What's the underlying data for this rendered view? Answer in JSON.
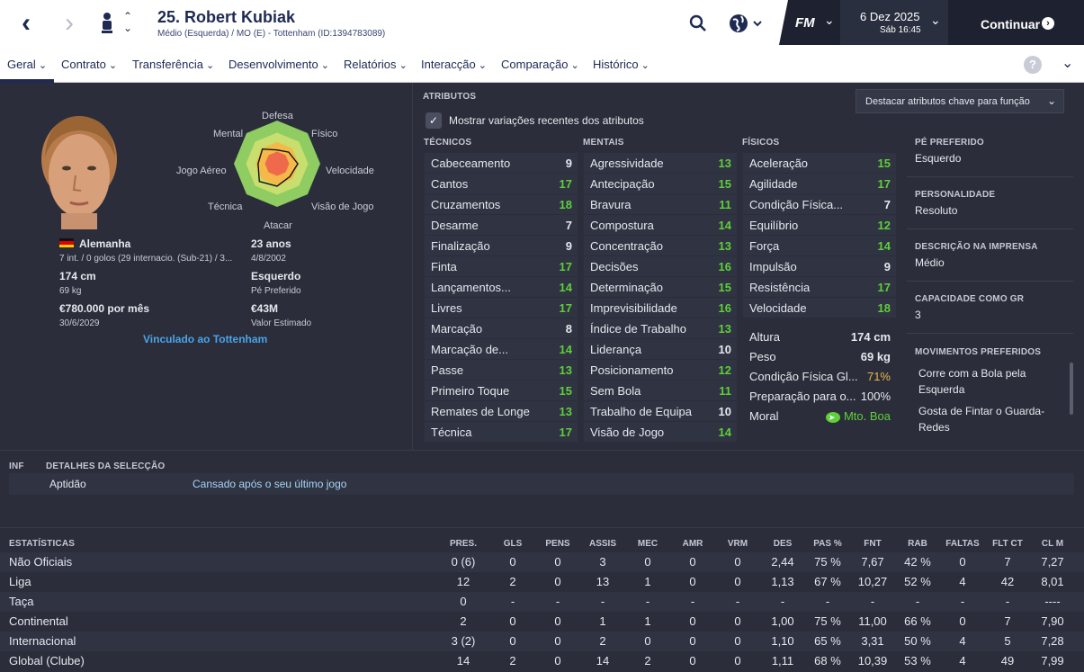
{
  "header": {
    "player_name": "25. Robert Kubiak",
    "subtitle": "Médio (Esquerda) / MO (E) - Tottenham (ID:1394783089)",
    "date": "6 Dez 2025",
    "day_time": "Sáb 16:45",
    "continue_label": "Continuar",
    "fm_logo": "FM"
  },
  "tabs": [
    "Geral",
    "Contrato",
    "Transferência",
    "Desenvolvimento",
    "Relatórios",
    "Interacção",
    "Comparação",
    "Histórico"
  ],
  "radar": {
    "labels": [
      "Defesa",
      "Físico",
      "Velocidade",
      "Visão de Jogo",
      "Atacar",
      "Técnica",
      "Jogo Aéreo",
      "Mental"
    ],
    "values": [
      0.32,
      0.38,
      0.48,
      0.42,
      0.52,
      0.58,
      0.44,
      0.48
    ]
  },
  "profile": {
    "nationality": "Alemanha",
    "caps": "7 int. / 0 golos (29 internacio. (Sub-21) / 3...",
    "age": "23 anos",
    "dob": "4/8/2002",
    "height": "174 cm",
    "height_lbl": "",
    "weight": "69 kg",
    "foot": "Esquerdo",
    "foot_lbl": "Pé Preferido",
    "wage": "€780.000 por mês",
    "contract": "30/6/2029",
    "value": "€43M",
    "value_lbl": "Valor Estimado",
    "club_link": "Vinculado ao Tottenham"
  },
  "attributes": {
    "title": "ATRIBUTOS",
    "highlight_btn": "Destacar atributos chave para função",
    "show_changes": "Mostrar variações recentes dos atributos",
    "tech_title": "TÉCNICOS",
    "ment_title": "MENTAIS",
    "phys_title": "FÍSICOS",
    "technical": [
      [
        "Cabeceamento",
        "9"
      ],
      [
        "Cantos",
        "17"
      ],
      [
        "Cruzamentos",
        "18"
      ],
      [
        "Desarme",
        "7"
      ],
      [
        "Finalização",
        "9"
      ],
      [
        "Finta",
        "17"
      ],
      [
        "Lançamentos...",
        "14"
      ],
      [
        "Livres",
        "17"
      ],
      [
        "Marcação",
        "8"
      ],
      [
        "Marcação de...",
        "14"
      ],
      [
        "Passe",
        "13"
      ],
      [
        "Primeiro Toque",
        "15"
      ],
      [
        "Remates de Longe",
        "13"
      ],
      [
        "Técnica",
        "17"
      ]
    ],
    "mental": [
      [
        "Agressividade",
        "13"
      ],
      [
        "Antecipação",
        "15"
      ],
      [
        "Bravura",
        "11"
      ],
      [
        "Compostura",
        "14"
      ],
      [
        "Concentração",
        "13"
      ],
      [
        "Decisões",
        "16"
      ],
      [
        "Determinação",
        "15"
      ],
      [
        "Imprevisibilidade",
        "16"
      ],
      [
        "Índice de Trabalho",
        "13"
      ],
      [
        "Liderança",
        "10"
      ],
      [
        "Posicionamento",
        "12"
      ],
      [
        "Sem Bola",
        "11"
      ],
      [
        "Trabalho de Equipa",
        "10"
      ],
      [
        "Visão de Jogo",
        "14"
      ]
    ],
    "physical": [
      [
        "Aceleração",
        "15"
      ],
      [
        "Agilidade",
        "17"
      ],
      [
        "Condição Física...",
        "7"
      ],
      [
        "Equilíbrio",
        "12"
      ],
      [
        "Força",
        "14"
      ],
      [
        "Impulsão",
        "9"
      ],
      [
        "Resistência",
        "17"
      ],
      [
        "Velocidade",
        "18"
      ]
    ],
    "extra": [
      [
        "Altura",
        "174 cm"
      ],
      [
        "Peso",
        "69 kg"
      ],
      [
        "Condição Física Gl...",
        "71%"
      ],
      [
        "Preparação para o...",
        "100%"
      ],
      [
        "Moral",
        "Mtо. Boa"
      ]
    ]
  },
  "side": {
    "foot_title": "PÉ PREFERIDO",
    "foot": "Esquerdo",
    "pers_title": "PERSONALIDADE",
    "pers": "Resoluto",
    "press_title": "DESCRIÇÃO NA IMPRENSA",
    "press": "Médio",
    "gk_title": "CAPACIDADE COMO GR",
    "gk": "3",
    "moves_title": "MOVIMENTOS PREFERIDOS",
    "moves": [
      "Corre com a Bola pela Esquerda",
      "Gosta de Fintar o Guarda-Redes"
    ]
  },
  "selection": {
    "inf": "INF",
    "title": "DETALHES DA SELECÇÃO",
    "label": "Aptidão",
    "value": "Cansado após o seu último jogo"
  },
  "stats": {
    "title": "ESTATÍSTICAS",
    "columns": [
      "PRES.",
      "GLS",
      "PENS",
      "ASSIS",
      "MEC",
      "AMR",
      "VRM",
      "DES",
      "PAS %",
      "FNT",
      "RAB",
      "FALTAS",
      "FLT CT",
      "CL M"
    ],
    "rows": [
      [
        "Não Oficiais",
        "0 (6)",
        "0",
        "0",
        "3",
        "0",
        "0",
        "0",
        "2,44",
        "75 %",
        "7,67",
        "42 %",
        "0",
        "7",
        "7,27"
      ],
      [
        "Liga",
        "12",
        "2",
        "0",
        "13",
        "1",
        "0",
        "0",
        "1,13",
        "67 %",
        "10,27",
        "52 %",
        "4",
        "42",
        "8,01"
      ],
      [
        "Taça",
        "0",
        "-",
        "-",
        "-",
        "-",
        "-",
        "-",
        "-",
        "-",
        "-",
        "-",
        "-",
        "-",
        "----"
      ],
      [
        "Continental",
        "2",
        "0",
        "0",
        "1",
        "1",
        "0",
        "0",
        "1,00",
        "75 %",
        "11,00",
        "66 %",
        "0",
        "7",
        "7,90"
      ],
      [
        "Internacional",
        "3 (2)",
        "0",
        "0",
        "2",
        "0",
        "0",
        "0",
        "1,10",
        "65 %",
        "3,31",
        "50 %",
        "4",
        "5",
        "7,28"
      ],
      [
        "Global (Clube)",
        "14",
        "2",
        "0",
        "14",
        "2",
        "0",
        "0",
        "1,11",
        "68 %",
        "10,39",
        "53 %",
        "4",
        "49",
        "7,99"
      ]
    ]
  }
}
